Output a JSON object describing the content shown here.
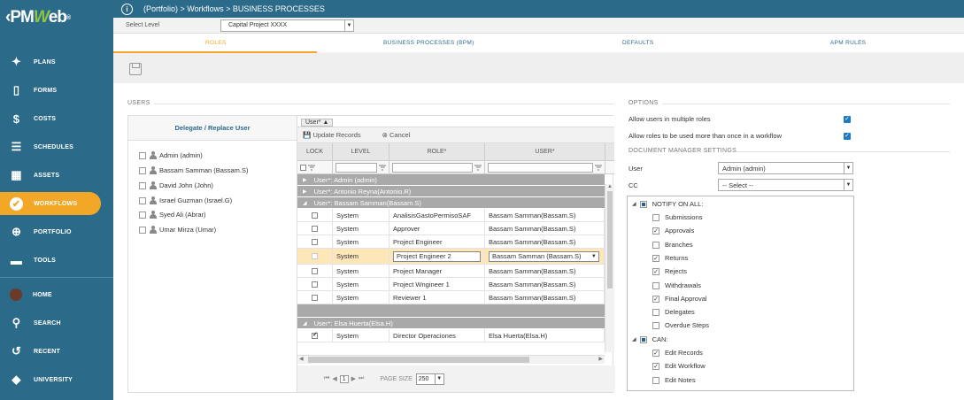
{
  "brand": {
    "logo_pre": "‹PM",
    "logo_w": "W",
    "logo_post": "eb",
    "reg": "®",
    "accent": "#f3a726",
    "primary": "#2b6a89"
  },
  "nav": [
    {
      "label": "PLANS",
      "icon": "lightbulb-icon"
    },
    {
      "label": "FORMS",
      "icon": "document-icon"
    },
    {
      "label": "COSTS",
      "icon": "dollar-icon"
    },
    {
      "label": "SCHEDULES",
      "icon": "gantt-icon"
    },
    {
      "label": "ASSETS",
      "icon": "building-icon"
    },
    {
      "label": "WORKFLOWS",
      "icon": "checkmark-icon",
      "active": true
    },
    {
      "label": "PORTFOLIO",
      "icon": "globe-icon"
    },
    {
      "label": "TOOLS",
      "icon": "toolbox-icon"
    },
    {
      "label": "HOME",
      "icon": "avatar-icon"
    },
    {
      "label": "SEARCH",
      "icon": "search-icon"
    },
    {
      "label": "RECENT",
      "icon": "history-icon"
    },
    {
      "label": "UNIVERSITY",
      "icon": "graduation-cap-icon"
    }
  ],
  "breadcrumb": "(Portfolio) > Workflows > BUSINESS PROCESSES",
  "level": {
    "label": "Select Level",
    "value": "Capital Project XXXX"
  },
  "tabs": [
    "ROLES",
    "BUSINESS PROCESSES (BPM)",
    "DEFAULTS",
    "APM RULES"
  ],
  "users_section": {
    "title": "USERS",
    "delegate_label": "Delegate / Replace User",
    "users": [
      "Admin (admin)",
      "Bassam Samman (Bassam.S)",
      "David John (John)",
      "Israel Guzman (Israel.G)",
      "Syed Ali (Abrar)",
      "Umar Mirza (Umar)"
    ]
  },
  "grid": {
    "groupby_chip": "User* ▲",
    "update": "Update Records",
    "cancel": "Cancel",
    "columns": [
      "LOCK",
      "LEVEL",
      "ROLE*",
      "USER*"
    ],
    "groups": [
      "User*: Admin (admin)",
      "User*: Antonio Reyna(Antonio.R)",
      "User*: Bassam Samman(Bassam.S)",
      "User*: Elsa Huerta(Elsa.H)"
    ],
    "rows": [
      {
        "lock": false,
        "level": "System",
        "role": "AnalisisGastoPermisoSAF",
        "user": "Bassam Samman(Bassam.S)"
      },
      {
        "lock": false,
        "level": "System",
        "role": "Approver",
        "user": "Bassam Samman(Bassam.S)"
      },
      {
        "lock": false,
        "level": "System",
        "role": "Project Engineer",
        "user": "Bassam Samman(Bassam.S)"
      },
      {
        "lock": false,
        "level": "System",
        "role": "Project Engineer 2",
        "user": "Bassam Samman (Bassam.S)",
        "selected": true
      },
      {
        "lock": false,
        "level": "System",
        "role": "Project Manager",
        "user": "Bassam Samman(Bassam.S)"
      },
      {
        "lock": false,
        "level": "System",
        "role": "Project Wngineer 1",
        "user": "Bassam Samman(Bassam.S)"
      },
      {
        "lock": false,
        "level": "System",
        "role": "Reviewer 1",
        "user": "Bassam Samman(Bassam.S)"
      }
    ],
    "elsa_row": {
      "lock": true,
      "level": "System",
      "role": "Director Operaciones",
      "user": "Elsa Huerta(Elsa.H)"
    },
    "page": "1",
    "page_size_label": "PAGE SIZE",
    "page_size": "250"
  },
  "options": {
    "title": "OPTIONS",
    "multi_roles": "Allow users in multiple roles",
    "roles_once": "Allow roles to be used more than once in a workflow",
    "dm_title": "DOCUMENT MANAGER SETTINGS",
    "user_label": "User",
    "user_value": "Admin  (admin)",
    "cc_label": "CC",
    "cc_value": "-- Select --",
    "tree": [
      {
        "label": "NOTIFY ON ALL:",
        "level": 0,
        "state": "partial"
      },
      {
        "label": "Submissions",
        "level": 1,
        "state": "off"
      },
      {
        "label": "Approvals",
        "level": 1,
        "state": "on"
      },
      {
        "label": "Branches",
        "level": 1,
        "state": "off"
      },
      {
        "label": "Returns",
        "level": 1,
        "state": "on"
      },
      {
        "label": "Rejects",
        "level": 1,
        "state": "on"
      },
      {
        "label": "Withdrawals",
        "level": 1,
        "state": "off"
      },
      {
        "label": "Final Approval",
        "level": 1,
        "state": "on"
      },
      {
        "label": "Delegates",
        "level": 1,
        "state": "off"
      },
      {
        "label": "Overdue Steps",
        "level": 1,
        "state": "off"
      },
      {
        "label": "CAN:",
        "level": 0,
        "state": "partial"
      },
      {
        "label": "Edit Records",
        "level": 1,
        "state": "on"
      },
      {
        "label": "Edit Workflow",
        "level": 1,
        "state": "on"
      },
      {
        "label": "Edit Notes",
        "level": 1,
        "state": "off"
      }
    ]
  }
}
